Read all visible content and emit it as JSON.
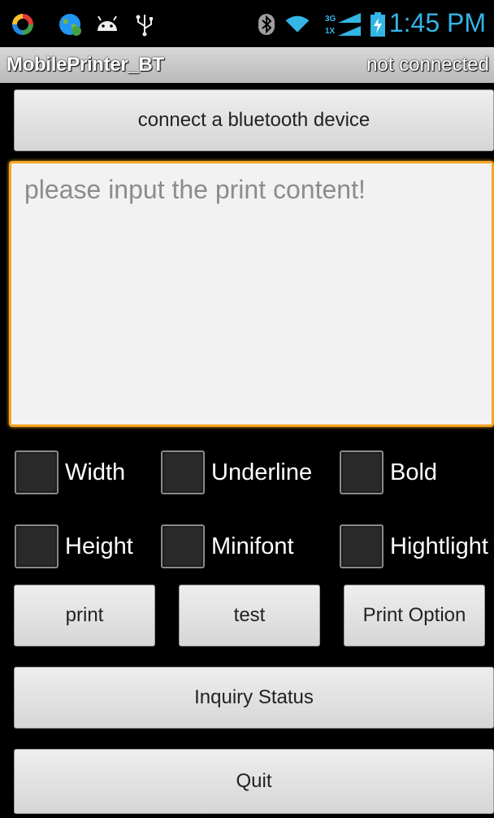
{
  "status_bar": {
    "time": "1:45 PM",
    "accent_color": "#33b5e5",
    "left_icons": [
      "sync-icon",
      "globe-icon",
      "android-icon",
      "usb-icon"
    ],
    "right_icons": [
      "bluetooth-icon",
      "wifi-icon",
      "signal-3g-1x-icon",
      "battery-charging-icon"
    ]
  },
  "title_bar": {
    "app_title": "MobilePrinter_BT",
    "connection_status": "not connected"
  },
  "connect_button": "connect a bluetooth device",
  "print_content": {
    "value": "",
    "placeholder": "please input the print content!",
    "focus_color": "#f5a623"
  },
  "options": [
    {
      "label": "Width",
      "checked": false
    },
    {
      "label": "Underline",
      "checked": false
    },
    {
      "label": "Bold",
      "checked": false
    },
    {
      "label": "Height",
      "checked": false
    },
    {
      "label": "Minifont",
      "checked": false
    },
    {
      "label": "Hightlight",
      "checked": false
    }
  ],
  "actions": {
    "print": "print",
    "test": "test",
    "print_option": "Print Option",
    "inquiry_status": "Inquiry Status",
    "quit": "Quit"
  }
}
